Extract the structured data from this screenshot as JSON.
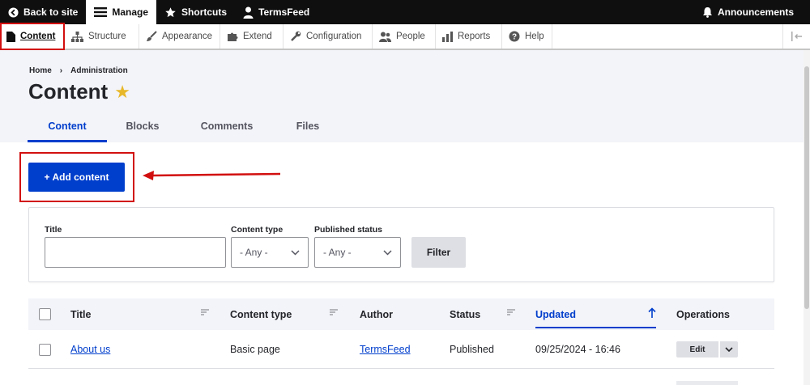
{
  "toolbar": {
    "back_to_site": "Back to site",
    "manage": "Manage",
    "shortcuts": "Shortcuts",
    "user": "TermsFeed",
    "announcements": "Announcements"
  },
  "tray": {
    "items": [
      {
        "label": "Content",
        "icon": "file-icon"
      },
      {
        "label": "Structure",
        "icon": "sitemap-icon"
      },
      {
        "label": "Appearance",
        "icon": "brush-icon"
      },
      {
        "label": "Extend",
        "icon": "puzzle-icon"
      },
      {
        "label": "Configuration",
        "icon": "wrench-icon"
      },
      {
        "label": "People",
        "icon": "people-icon"
      },
      {
        "label": "Reports",
        "icon": "bar-chart-icon"
      },
      {
        "label": "Help",
        "icon": "help-icon"
      }
    ]
  },
  "breadcrumb": [
    "Home",
    "Administration"
  ],
  "page": {
    "title": "Content",
    "star": "★"
  },
  "tabs": [
    "Content",
    "Blocks",
    "Comments",
    "Files"
  ],
  "actions": {
    "add_content": "+ Add content"
  },
  "filters": {
    "title_label": "Title",
    "title_value": "",
    "content_type_label": "Content type",
    "content_type_value": "- Any -",
    "published_label": "Published status",
    "published_value": "- Any -",
    "filter_button": "Filter"
  },
  "table": {
    "headers": [
      "Title",
      "Content type",
      "Author",
      "Status",
      "Updated",
      "Operations"
    ],
    "rows": [
      {
        "title": "About us",
        "content_type": "Basic page",
        "author": "TermsFeed",
        "status": "Published",
        "updated": "09/25/2024 - 16:46",
        "operation": "Edit"
      }
    ]
  },
  "colors": {
    "primary": "#003ecc",
    "highlight": "#d20f0f",
    "toolbar": "#0f0f0f",
    "star": "#e8b82a"
  }
}
